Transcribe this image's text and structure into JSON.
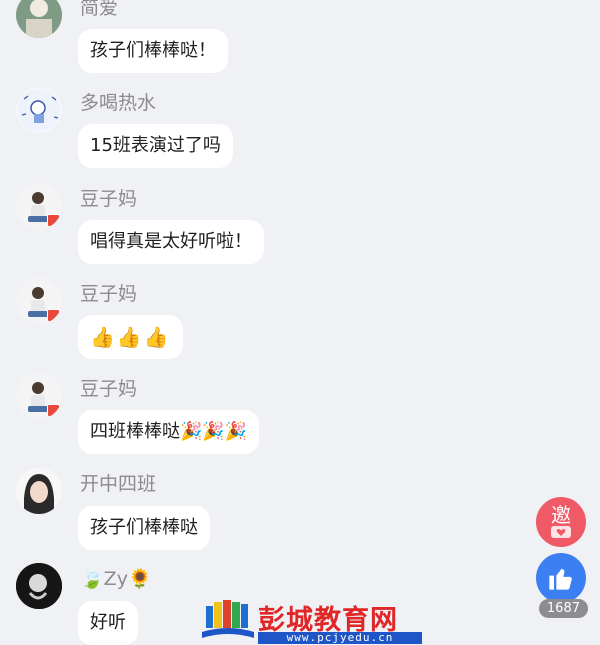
{
  "messages": [
    {
      "name": "简爱",
      "text": "孩子们棒棒哒！"
    },
    {
      "name": "多喝热水",
      "text": "15班表演过了吗"
    },
    {
      "name": "豆子妈",
      "text": "唱得真是太好听啦！"
    },
    {
      "name": "豆子妈",
      "text": "👍👍👍"
    },
    {
      "name": "豆子妈",
      "text": "四班棒棒哒",
      "emoji": "🎉🎉🎉"
    },
    {
      "name": "开中四班",
      "text": "孩子们棒棒哒"
    },
    {
      "name": "Zy",
      "name_prefix_emoji": "🍃",
      "name_suffix_emoji": "🌻",
      "text": "好听"
    }
  ],
  "invite_button": {
    "label": "邀"
  },
  "like_button": {
    "count": "1687"
  },
  "watermark": {
    "title": "彭城教育网",
    "url": "www.pcjyedu.cn"
  },
  "colors": {
    "background": "#f0f1f5",
    "bubble": "#ffffff",
    "invite": "#f05a66",
    "like": "#3b7ff2",
    "watermark_red": "#e02626",
    "watermark_blue": "#1f56c7"
  }
}
